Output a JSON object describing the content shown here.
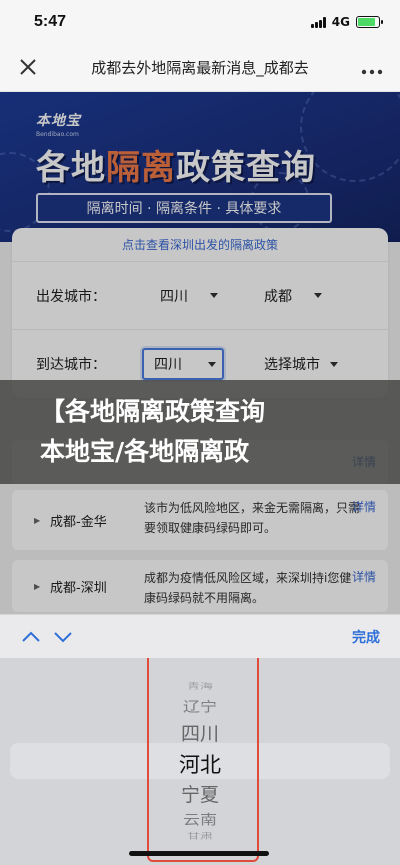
{
  "status_bar": {
    "time": "5:47",
    "network": "4G"
  },
  "nav": {
    "title": "成都去外地隔离最新消息_成都去",
    "close_icon": "close-icon",
    "more_icon": "more-dots-icon"
  },
  "banner": {
    "logo": "本地宝",
    "logo_sub": "Bendibao.com",
    "title_part1": "各地",
    "title_highlight": "隔离",
    "title_part2": "政策查询",
    "subtitle": "隔离时间 · 隔离条件 · 具体要求",
    "highlight_color": "#f07a4a",
    "bg_color": "#1e3d9a"
  },
  "card": {
    "link": "点击查看深圳出发的隔离政策",
    "departure": {
      "label": "出发城市：",
      "province": "四川",
      "city": "成都"
    },
    "arrival": {
      "label": "到达城市：",
      "province": "四川",
      "city": "选择城市"
    }
  },
  "headline": {
    "line1": "【各地隔离政策查询",
    "line2": "本地宝/各地隔离政"
  },
  "results": [
    {
      "route": "",
      "text": "",
      "detail": "详情"
    },
    {
      "route": "成都-金华",
      "text": "该市为低风险地区，来金无需隔离，只需要领取健康码绿码即可。",
      "detail": "详情"
    },
    {
      "route": "成都-深圳",
      "text": "成都为疫情低风险区域，来深圳持i您健康码绿码就不用隔离。",
      "detail": "详情"
    }
  ],
  "picker_toolbar": {
    "up_icon": "chevron-up-icon",
    "down_icon": "chevron-down-icon",
    "done": "完成",
    "accent_color": "#2e6fd8"
  },
  "picker": {
    "items": [
      "青海",
      "辽宁",
      "四川",
      "河北",
      "宁夏",
      "云南",
      "甘肃"
    ],
    "selected": "河北",
    "highlight_color": "#e24a3b"
  }
}
